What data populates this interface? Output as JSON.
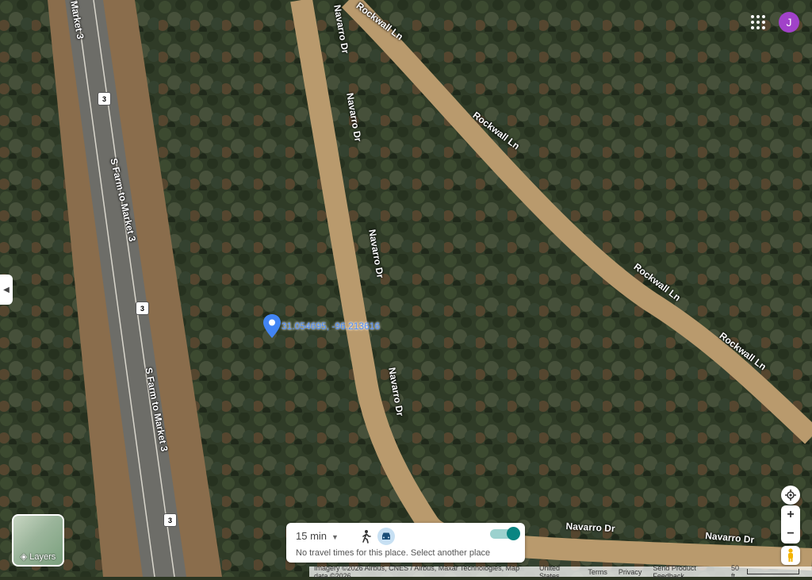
{
  "map": {
    "roads": [
      {
        "id": "fm3-a",
        "label": "Market 3"
      },
      {
        "id": "fm3-b",
        "label": "S Farm to Market 3"
      },
      {
        "id": "fm3-c",
        "label": "S Farm to Market 3"
      },
      {
        "id": "rockwall-a",
        "label": "Rockwall Ln"
      },
      {
        "id": "rockwall-b",
        "label": "Rockwall Ln"
      },
      {
        "id": "rockwall-c",
        "label": "Rockwall Ln"
      },
      {
        "id": "rockwall-d",
        "label": "Rockwall Ln"
      },
      {
        "id": "navarro-a",
        "label": "Navarro Dr"
      },
      {
        "id": "navarro-b",
        "label": "Navarro Dr"
      },
      {
        "id": "navarro-c",
        "label": "Navarro Dr"
      },
      {
        "id": "navarro-d",
        "label": "Navarro Dr"
      },
      {
        "id": "navarro-e",
        "label": "Navarro Dr"
      },
      {
        "id": "navarro-f",
        "label": "Navarro Dr"
      }
    ],
    "route_shields": [
      "3",
      "3",
      "3"
    ],
    "pin": {
      "coordinates": "31.054695, -96.213616",
      "icon": "map-pin-icon",
      "color": "#4285f4"
    }
  },
  "header": {
    "apps_icon": "apps-grid-icon",
    "avatar_letter": "J",
    "avatar_color": "#a142c9"
  },
  "side_panel_toggle": {
    "icon": "chevron-left-icon"
  },
  "layers": {
    "label": "Layers",
    "icon": "layers-icon"
  },
  "travel": {
    "time": "15 min",
    "message": "No travel times for this place. Select another place",
    "modes": [
      "walk-icon",
      "car-icon"
    ],
    "toggle_on": true,
    "accent": "#0a8582"
  },
  "controls": {
    "locate_icon": "my-location-icon",
    "zoom_in": "+",
    "zoom_out": "−",
    "pegman_icon": "pegman-icon"
  },
  "footer": {
    "imagery": "Imagery ©2026 Airbus, CNES / Airbus, Maxar Technologies, Map data ©2026",
    "country": "United States",
    "terms": "Terms",
    "privacy": "Privacy",
    "feedback": "Send Product Feedback",
    "scale": "50 ft"
  }
}
